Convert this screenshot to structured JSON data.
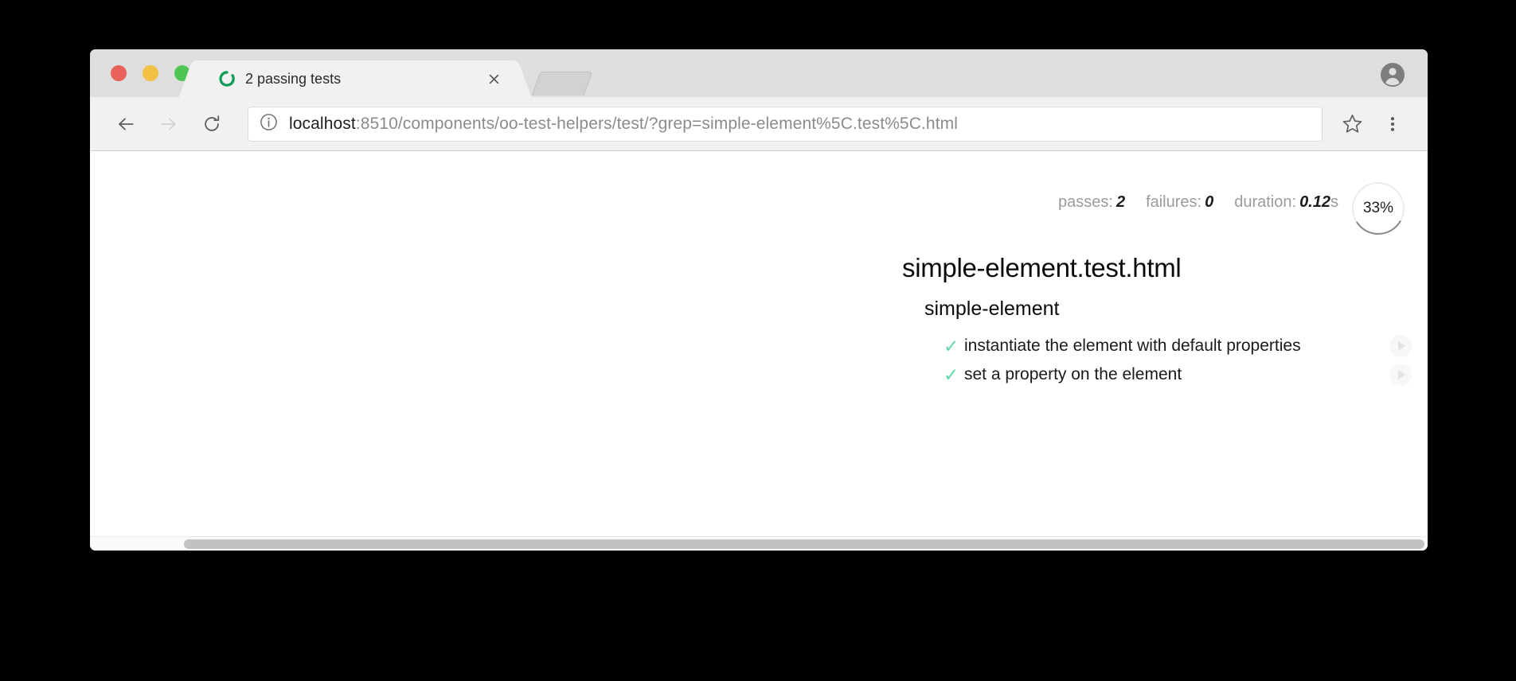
{
  "window": {
    "traffic_lights": [
      {
        "name": "close",
        "color": "#e8615a"
      },
      {
        "name": "minimize",
        "color": "#f2c044"
      },
      {
        "name": "zoom",
        "color": "#4fc553"
      }
    ]
  },
  "tab": {
    "title": "2 passing tests",
    "favicon": "mocha-spinner-icon",
    "favicon_color": "#0f9d58",
    "close_label": "×",
    "new_tab_label": ""
  },
  "toolbar": {
    "back_icon": "arrow-left-icon",
    "forward_icon": "arrow-right-icon",
    "reload_icon": "reload-icon",
    "info_icon": "info-circle-icon",
    "star_icon": "star-outline-icon",
    "menu_icon": "three-dot-menu-icon",
    "avatar_icon": "account-avatar-icon"
  },
  "address": {
    "host": "localhost",
    "path": ":8510/components/oo-test-helpers/test/?grep=simple-element%5C.test%5C.html",
    "full": "localhost:8510/components/oo-test-helpers/test/?grep=simple-element%5C.test%5C.html"
  },
  "stats": {
    "passes_label": "passes:",
    "passes_value": "2",
    "failures_label": "failures:",
    "failures_value": "0",
    "duration_label": "duration:",
    "duration_value": "0.12",
    "duration_unit": "s",
    "progress_percent": "33%",
    "progress_fraction": 33
  },
  "report": {
    "suite_title": "simple-element.test.html",
    "suite_name": "simple-element",
    "tests": [
      {
        "status_icon": "✓",
        "name": "instantiate the element with default properties",
        "replay_icon": "play-icon"
      },
      {
        "status_icon": "✓",
        "name": "set a property on the element",
        "replay_icon": "play-icon"
      }
    ]
  }
}
